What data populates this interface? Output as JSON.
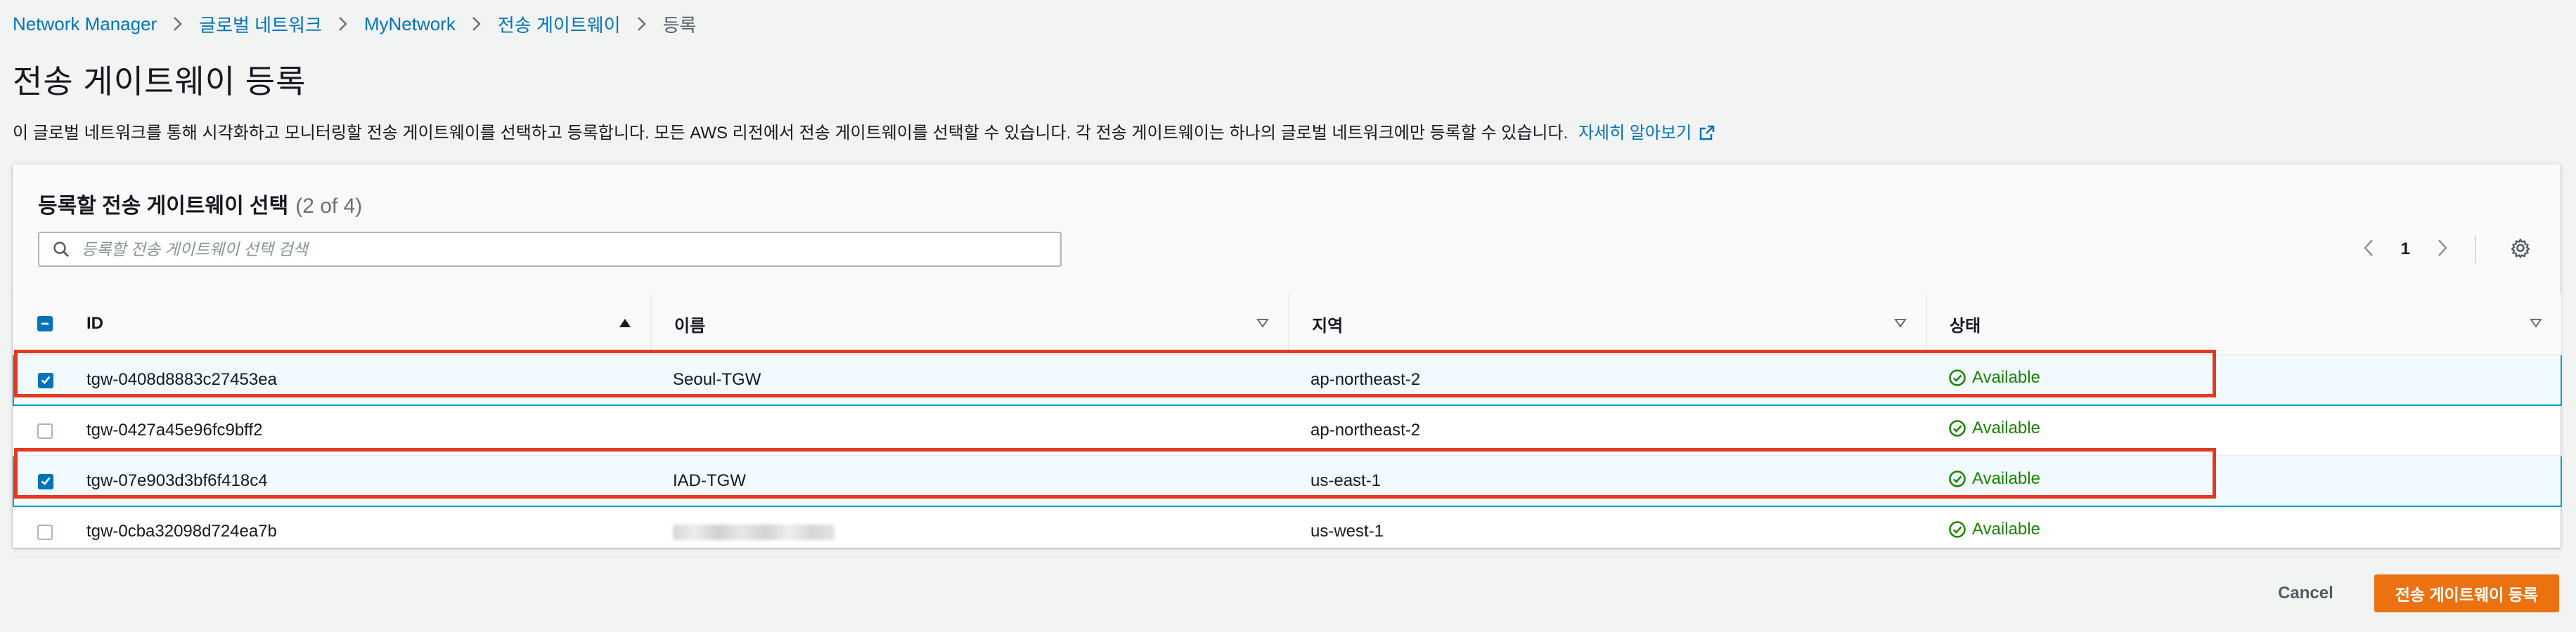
{
  "breadcrumb": {
    "items": [
      "Network Manager",
      "글로벌 네트워크",
      "MyNetwork",
      "전송 게이트웨이"
    ],
    "current": "등록"
  },
  "page": {
    "title": "전송 게이트웨이 등록",
    "description": "이 글로벌 네트워크를 통해 시각화하고 모니터링할 전송 게이트웨이를 선택하고 등록합니다. 모든 AWS 리전에서 전송 게이트웨이를 선택할 수 있습니다. 각 전송 게이트웨이는 하나의 글로벌 네트워크에만 등록할 수 있습니다.",
    "learn_more": "자세히 알아보기"
  },
  "table": {
    "title": "등록할 전송 게이트웨이 선택",
    "count": "(2 of 4)",
    "search_placeholder": "등록할 전송 게이트웨이 선택 검색",
    "page_number": "1",
    "columns": {
      "id": "ID",
      "name": "이름",
      "region": "지역",
      "status": "상태"
    },
    "rows": [
      {
        "selected": true,
        "id": "tgw-0408d8883c27453ea",
        "name": "Seoul-TGW",
        "region": "ap-northeast-2",
        "status": "Available"
      },
      {
        "selected": false,
        "id": "tgw-0427a45e96fc9bff2",
        "name": "",
        "region": "ap-northeast-2",
        "status": "Available"
      },
      {
        "selected": true,
        "id": "tgw-07e903d3bf6f418c4",
        "name": "IAD-TGW",
        "region": "us-east-1",
        "status": "Available"
      },
      {
        "selected": false,
        "id": "tgw-0cba32098d724ea7b",
        "name": "",
        "region": "us-west-1",
        "status": "Available"
      }
    ]
  },
  "actions": {
    "cancel": "Cancel",
    "submit": "전송 게이트웨이 등록"
  },
  "colors": {
    "link": "#0073bb",
    "primary": "#ec7211",
    "success": "#1d8102",
    "highlight": "#e03a23",
    "selected_row": "#f1faff"
  },
  "icons": [
    "chevron-right-icon",
    "external-link-icon",
    "search-icon",
    "chevron-left-icon",
    "gear-icon",
    "sort-ascending-icon",
    "sort-descending-icon",
    "check-circle-icon",
    "checkbox-check-icon",
    "checkbox-indeterminate-icon"
  ]
}
